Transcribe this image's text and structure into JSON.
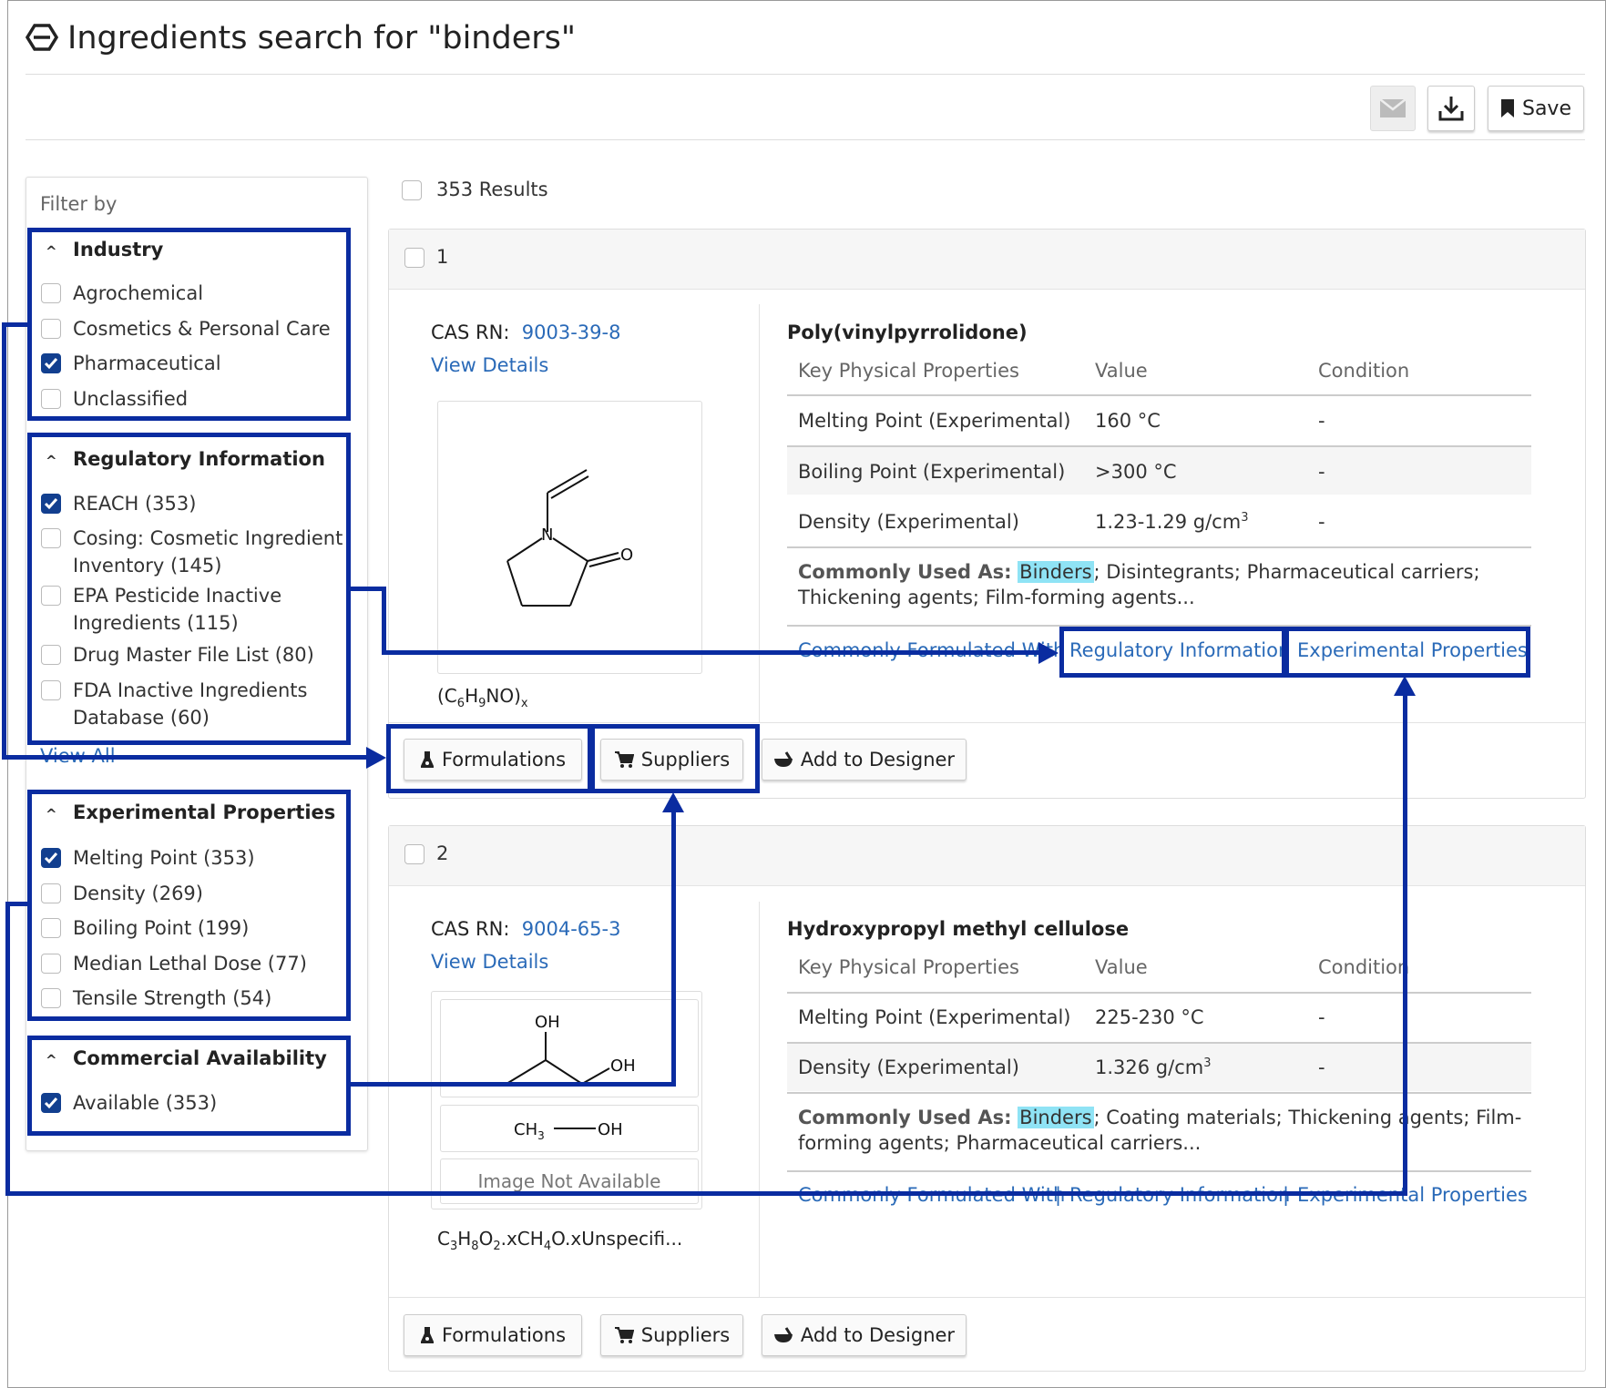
{
  "title": "Ingredients search for \"binders\"",
  "toolbar": {
    "save_label": "Save"
  },
  "filter": {
    "label": "Filter by",
    "view_all": "View All",
    "sections": [
      {
        "title": "Industry",
        "options": [
          {
            "label": "Agrochemical",
            "checked": false
          },
          {
            "label": "Cosmetics & Personal Care",
            "checked": false
          },
          {
            "label": "Pharmaceutical",
            "checked": true
          },
          {
            "label": "Unclassified",
            "checked": false
          }
        ]
      },
      {
        "title": "Regulatory Information",
        "options": [
          {
            "label": "REACH (353)",
            "checked": true
          },
          {
            "label": "Cosing: Cosmetic Ingredient",
            "label2": "Inventory (145)",
            "checked": false
          },
          {
            "label": "EPA Pesticide Inactive",
            "label2": "Ingredients (115)",
            "checked": false
          },
          {
            "label": "Drug Master File List (80)",
            "checked": false
          },
          {
            "label": "FDA Inactive Ingredients",
            "label2": "Database (60)",
            "checked": false
          }
        ]
      },
      {
        "title": "Experimental Properties",
        "options": [
          {
            "label": "Melting Point (353)",
            "checked": true
          },
          {
            "label": "Density (269)",
            "checked": false
          },
          {
            "label": "Boiling Point (199)",
            "checked": false
          },
          {
            "label": "Median Lethal Dose (77)",
            "checked": false
          },
          {
            "label": "Tensile Strength (54)",
            "checked": false
          }
        ]
      },
      {
        "title": "Commercial Availability",
        "options": [
          {
            "label": "Available (353)",
            "checked": true
          }
        ]
      }
    ]
  },
  "results": {
    "count_label": "353 Results",
    "items": [
      {
        "index": "1",
        "cas_label": "CAS RN:",
        "cas": "9003-39-8",
        "view_details": "View Details",
        "name": "Poly(vinylpyrrolidone)",
        "formula": "(C6H9NO)x",
        "table_headers": [
          "Key Physical Properties",
          "Value",
          "Condition"
        ],
        "rows": [
          {
            "prop": "Melting Point (Experimental)",
            "value": "160 °C",
            "cond": "-"
          },
          {
            "prop": "Boiling Point (Experimental)",
            "value": ">300 °C",
            "cond": "-"
          },
          {
            "prop": "Density (Experimental)",
            "value": "1.23-1.29 g/cm",
            "sup": "3",
            "cond": "-"
          }
        ],
        "used_label": "Commonly Used As:",
        "used_highlight": "Binders",
        "used_rest": "; Disintegrants; Pharmaceutical carriers; Thickening agents; Film-forming agents...",
        "links": [
          "Commonly Formulated With",
          "Regulatory Information",
          "Experimental Properties"
        ],
        "structure_atoms": {
          "n": "N",
          "o": "O"
        },
        "buttons": [
          "Formulations",
          "Suppliers",
          "Add to Designer"
        ]
      },
      {
        "index": "2",
        "cas_label": "CAS RN:",
        "cas": "9004-65-3",
        "view_details": "View Details",
        "name": "Hydroxypropyl methyl cellulose",
        "formula": "C3H8O2.xCH4O.xUnspecifi...",
        "table_headers": [
          "Key Physical Properties",
          "Value",
          "Condition"
        ],
        "rows": [
          {
            "prop": "Melting Point (Experimental)",
            "value": "225-230 °C",
            "cond": "-"
          },
          {
            "prop": "Density (Experimental)",
            "value": "1.326 g/cm",
            "sup": "3",
            "cond": "-"
          }
        ],
        "used_label": "Commonly Used As:",
        "used_highlight": "Binders",
        "used_rest": "; Coating materials; Thickening agents; Film-forming agents; Pharmaceutical carriers...",
        "links": [
          "Commonly Formulated With",
          "Regulatory Information",
          "Experimental Properties"
        ],
        "link_separator": "|",
        "structure_labels": {
          "oh1": "OH",
          "oh2": "OH",
          "ch3": "CH",
          "ch3_sub": "3",
          "oh3": "OH"
        },
        "no_image": "Image Not Available",
        "buttons": [
          "Formulations",
          "Suppliers",
          "Add to Designer"
        ]
      }
    ]
  },
  "colors": {
    "highlight_box": "#0a2ca0",
    "link": "#2a6ab8",
    "checkbox_on": "#123f8f",
    "binder_highlight": "#8fe3f5"
  }
}
